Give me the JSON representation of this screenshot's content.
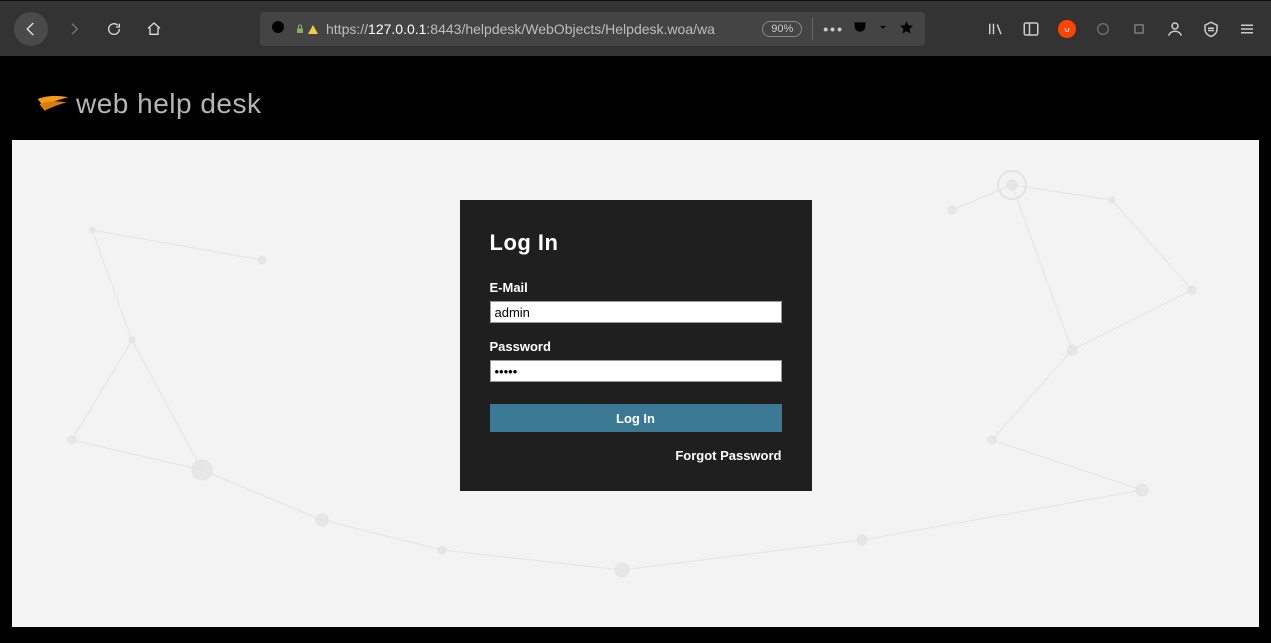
{
  "browser": {
    "url_prefix": "https://",
    "url_host": "127.0.0.1",
    "url_suffix": ":8443/helpdesk/WebObjects/Helpdesk.woa/wa",
    "zoom": "90%"
  },
  "brand": {
    "name": "web help desk"
  },
  "login": {
    "title": "Log In",
    "email_label": "E-Mail",
    "email_value": "admin",
    "password_label": "Password",
    "password_value": "•••••",
    "submit_label": "Log In",
    "forgot_label": "Forgot Password"
  }
}
